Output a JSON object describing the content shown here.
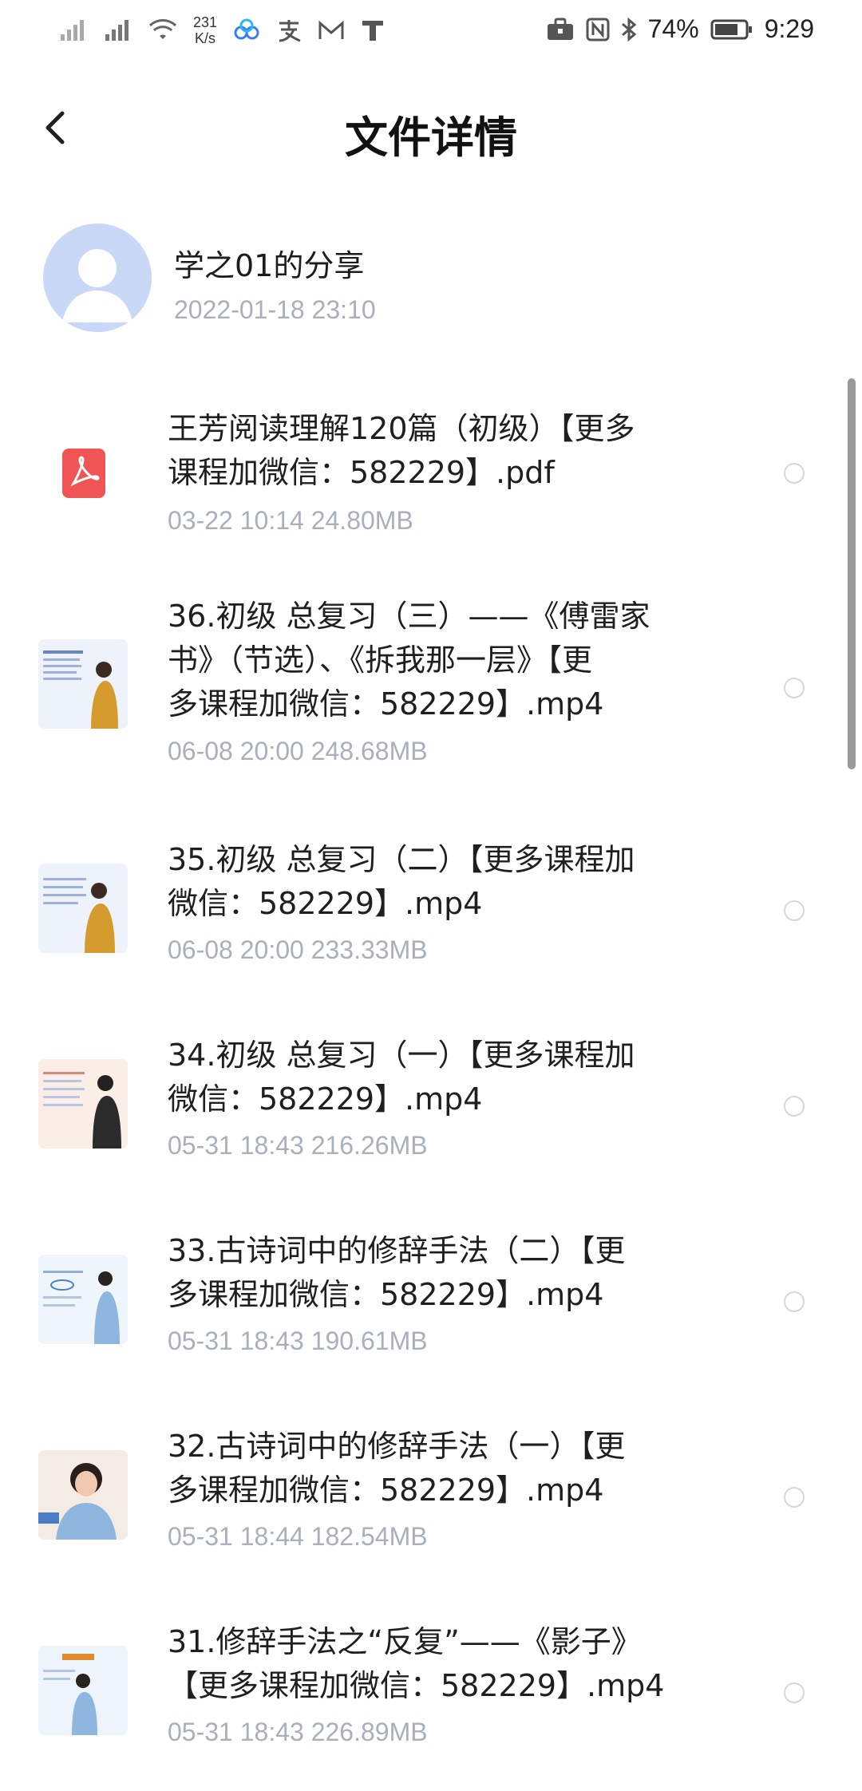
{
  "status_bar": {
    "net_speed_value": "231",
    "net_speed_unit": "K/s",
    "battery": "74%",
    "time": "9:29"
  },
  "header": {
    "title": "文件详情"
  },
  "sharer": {
    "name": "学之01的分享",
    "time": "2022-01-18  23:10"
  },
  "files": [
    {
      "name_line1": "王芳阅读理解120篇（初级）【更多",
      "name_line2": "课程加微信：582229】.pdf",
      "name_line3": "",
      "meta": "03-22  10:14   24.80MB",
      "type_icon": "pdf-icon"
    },
    {
      "name_line1": "36.初级 总复习（三）——《傅雷家",
      "name_line2": "书》（节选）、《拆我那一层》【更",
      "name_line3": "多课程加微信：582229】.mp4",
      "meta": "06-08  20:00   248.68MB",
      "type_icon": "video-thumbnail"
    },
    {
      "name_line1": "35.初级 总复习（二）【更多课程加",
      "name_line2": "微信：582229】.mp4",
      "name_line3": "",
      "meta": "06-08  20:00   233.33MB",
      "type_icon": "video-thumbnail"
    },
    {
      "name_line1": "34.初级 总复习（一）【更多课程加",
      "name_line2": "微信：582229】.mp4",
      "name_line3": "",
      "meta": "05-31  18:43   216.26MB",
      "type_icon": "video-thumbnail"
    },
    {
      "name_line1": "33.古诗词中的修辞手法（二）【更",
      "name_line2": "多课程加微信：582229】.mp4",
      "name_line3": "",
      "meta": "05-31  18:43   190.61MB",
      "type_icon": "video-thumbnail"
    },
    {
      "name_line1": "32.古诗词中的修辞手法（一）【更",
      "name_line2": "多课程加微信：582229】.mp4",
      "name_line3": "",
      "meta": "05-31  18:44   182.54MB",
      "type_icon": "video-thumbnail"
    },
    {
      "name_line1": "31.修辞手法之“反复”——《影子》",
      "name_line2": "【更多课程加微信：582229】.mp4",
      "name_line3": "",
      "meta": "05-31  18:43   226.89MB",
      "type_icon": "video-thumbnail"
    }
  ]
}
